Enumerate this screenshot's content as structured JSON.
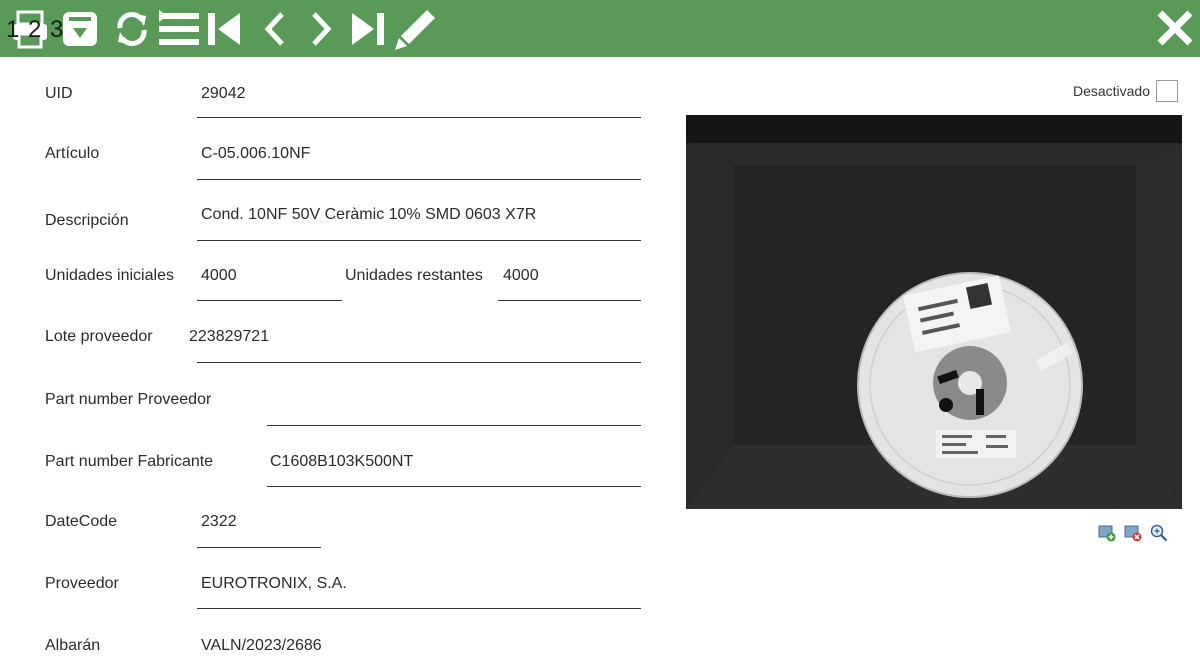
{
  "toolbar": {
    "tab_numbers": "1 2 3",
    "icons": [
      "printer-icon",
      "save-icon",
      "refresh-icon",
      "list-icon",
      "first-icon",
      "previous-icon",
      "next-icon",
      "last-icon",
      "edit-icon",
      "close-icon"
    ]
  },
  "form": {
    "uid": {
      "label": "UID",
      "value": "29042"
    },
    "articulo": {
      "label": "Artículo",
      "value": "C-05.006.10NF"
    },
    "descripcion": {
      "label": "Descripción",
      "value": "Cond. 10NF 50V Ceràmic 10% SMD 0603 X7R"
    },
    "unidades_iniciales": {
      "label": "Unidades iniciales",
      "value": "4000"
    },
    "unidades_restantes": {
      "label": "Unidades restantes",
      "value": "4000"
    },
    "lote_proveedor": {
      "label": "Lote proveedor",
      "value": "223829721"
    },
    "pn_proveedor": {
      "label": "Part number Proveedor",
      "value": ""
    },
    "pn_fabricante": {
      "label": "Part number Fabricante",
      "value": "C1608B103K500NT"
    },
    "datecode": {
      "label": "DateCode",
      "value": "2322"
    },
    "proveedor": {
      "label": "Proveedor",
      "value": "EUROTRONIX, S.A."
    },
    "albaran": {
      "label": "Albarán",
      "value": "VALN/2023/2686"
    }
  },
  "desactivado": {
    "label": "Desactivado",
    "checked": false
  },
  "image_tools": [
    "add-image-icon",
    "remove-image-icon",
    "zoom-icon"
  ],
  "colors": {
    "toolbar": "#5a9a59"
  }
}
